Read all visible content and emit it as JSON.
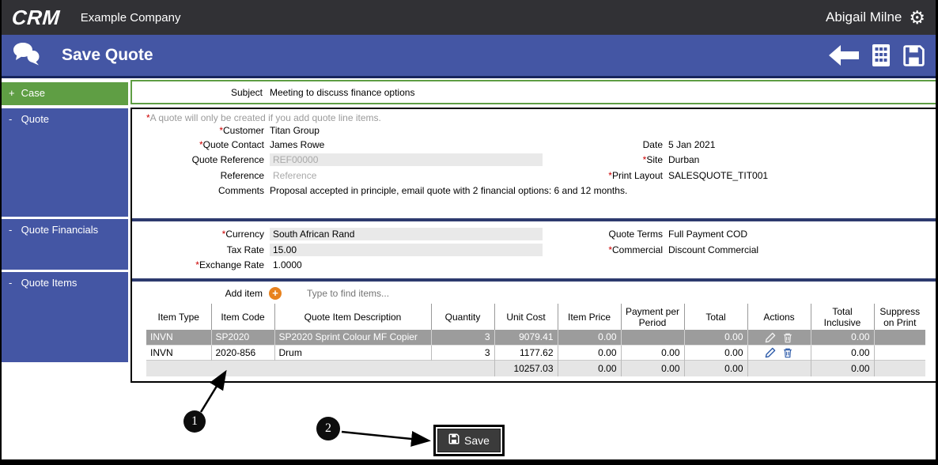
{
  "required_marker": "*",
  "icons": {
    "gear": "⚙",
    "add_item_plus": "+"
  },
  "topbar": {
    "logo": "CRM",
    "company": "Example Company",
    "user": "Abigail Milne"
  },
  "banner": {
    "title": "Save Quote"
  },
  "sidebar": {
    "items": [
      {
        "prefix": "+",
        "label": "Case"
      },
      {
        "prefix": "-",
        "label": "Quote"
      },
      {
        "prefix": "-",
        "label": "Quote Financials"
      },
      {
        "prefix": "-",
        "label": "Quote Items"
      }
    ]
  },
  "form": {
    "subject": {
      "label": "Subject",
      "value": "Meeting to discuss finance options"
    },
    "quote": {
      "warning": "A quote will only be created if you add quote line items.",
      "customer": {
        "label": "Customer",
        "value": "Titan Group"
      },
      "quote_contact": {
        "label": "Quote Contact",
        "value": "James Rowe"
      },
      "quote_reference": {
        "label": "Quote Reference",
        "value": "REF00000"
      },
      "reference": {
        "label": "Reference",
        "placeholder": "Reference"
      },
      "comments": {
        "label": "Comments",
        "value": "Proposal accepted in principle, email quote with 2 financial options: 6 and 12 months."
      },
      "date": {
        "label": "Date",
        "value": "5 Jan 2021"
      },
      "site": {
        "label": "Site",
        "value": "Durban"
      },
      "print_layout": {
        "label": "Print Layout",
        "value": "SALESQUOTE_TIT001"
      }
    },
    "financials": {
      "currency": {
        "label": "Currency",
        "value": "South African Rand"
      },
      "tax_rate": {
        "label": "Tax Rate",
        "value": "15.00"
      },
      "exchange_rate": {
        "label": "Exchange Rate",
        "value": "1.0000"
      },
      "quote_terms": {
        "label": "Quote Terms",
        "value": "Full Payment COD"
      },
      "commercial": {
        "label": "Commercial",
        "value": "Discount Commercial"
      }
    },
    "items": {
      "add_item_label": "Add item",
      "find_placeholder": "Type to find items...",
      "columns": [
        "Item Type",
        "Item Code",
        "Quote Item Description",
        "Quantity",
        "Unit Cost",
        "Item Price",
        "Payment per Period",
        "Total",
        "Actions",
        "Total Inclusive",
        "Suppress on Print"
      ],
      "rows": [
        {
          "item_type": "INVN",
          "item_code": "SP2020",
          "description": "SP2020 Sprint Colour MF Copier",
          "quantity": "3",
          "unit_cost": "9079.41",
          "item_price": "0.00",
          "payment_per_period": "",
          "total": "0.00",
          "total_inclusive": "0.00",
          "suppress_on_print": ""
        },
        {
          "item_type": "INVN",
          "item_code": "2020-856",
          "description": "Drum",
          "quantity": "3",
          "unit_cost": "1177.62",
          "item_price": "0.00",
          "payment_per_period": "0.00",
          "total": "0.00",
          "total_inclusive": "0.00",
          "suppress_on_print": ""
        }
      ],
      "totals": {
        "unit_cost": "10257.03",
        "item_price": "0.00",
        "payment_per_period": "0.00",
        "total": "0.00",
        "total_inclusive": "0.00"
      }
    }
  },
  "annotations": {
    "step1": "1",
    "step2": "2",
    "save_button_label": "Save"
  },
  "colors": {
    "topbar_dark": "#313135",
    "banner_blue": "#4456a4",
    "case_green": "#5f9e44",
    "separator_navy": "#2d3a6e",
    "selected_row_grey": "#9c9c9c",
    "totals_row_grey": "#e5e5e5",
    "field_grey": "#e9e9e9",
    "add_icon_orange": "#e8821e",
    "action_icon_blue": "#2d5ba9",
    "required_red": "#cc0000"
  }
}
